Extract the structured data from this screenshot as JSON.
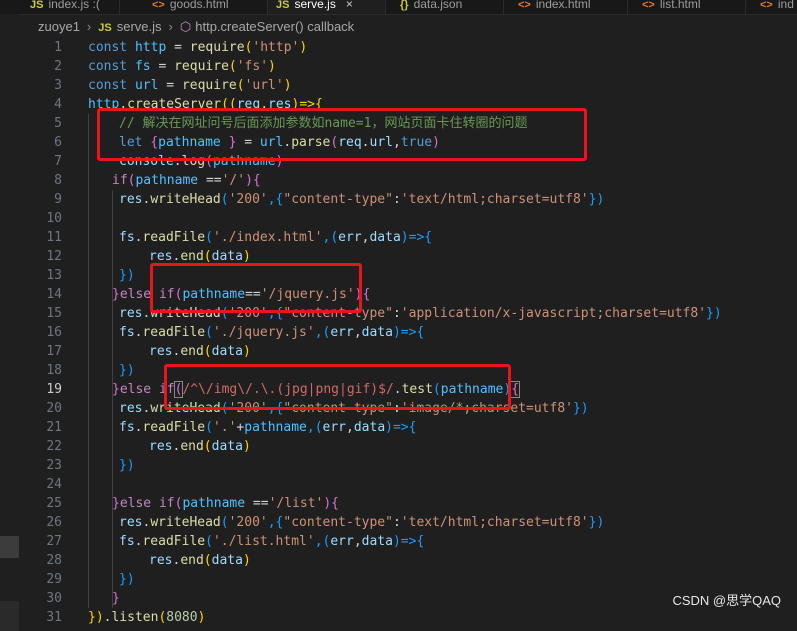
{
  "tabs": [
    {
      "label": "index.js",
      "modified": ":(",
      "icon": "JS"
    },
    {
      "label": "goods.html",
      "icon": "<>"
    },
    {
      "label": "serve.js",
      "icon": "JS",
      "active": true,
      "close": "×"
    },
    {
      "label": "data.json",
      "icon": "{}"
    },
    {
      "label": "index.html",
      "icon": "<>"
    },
    {
      "label": "list.html",
      "icon": "<>"
    },
    {
      "label": "ind",
      "icon": "<>"
    }
  ],
  "breadcrumb": {
    "folder": "zuoye1",
    "file_icon": "JS",
    "file": "serve.js",
    "symbol": "http.createServer() callback"
  },
  "active_line": "19",
  "lines": [
    {
      "n": "1"
    },
    {
      "n": "2"
    },
    {
      "n": "3"
    },
    {
      "n": "4"
    },
    {
      "n": "5"
    },
    {
      "n": "6"
    },
    {
      "n": "7"
    },
    {
      "n": "8"
    },
    {
      "n": "9"
    },
    {
      "n": "10"
    },
    {
      "n": "11"
    },
    {
      "n": "12"
    },
    {
      "n": "13"
    },
    {
      "n": "14"
    },
    {
      "n": "15"
    },
    {
      "n": "16"
    },
    {
      "n": "17"
    },
    {
      "n": "18"
    },
    {
      "n": "19"
    },
    {
      "n": "20"
    },
    {
      "n": "21"
    },
    {
      "n": "22"
    },
    {
      "n": "23"
    },
    {
      "n": "24"
    },
    {
      "n": "25"
    },
    {
      "n": "26"
    },
    {
      "n": "27"
    },
    {
      "n": "28"
    },
    {
      "n": "29"
    },
    {
      "n": "30"
    },
    {
      "n": "31"
    }
  ],
  "code": {
    "l1": [
      "const ",
      "http",
      " = ",
      "require",
      "(",
      "'http'",
      ")"
    ],
    "l2": [
      "const ",
      "fs",
      " = ",
      "require",
      "(",
      "'fs'",
      ")"
    ],
    "l3": [
      "const ",
      "url",
      " = ",
      "require",
      "(",
      "'url'",
      ")"
    ],
    "l4": [
      "http",
      ".",
      "createServer",
      "((",
      "req",
      ",",
      "res",
      ")=>{"
    ],
    "l5": "// 解决在网址问号后面添加参数如name=1，网站页面卡住转圈的问题",
    "l6": [
      "let ",
      "{",
      "pathname ",
      "}",
      " = ",
      "url",
      ".",
      "parse",
      "(",
      "req",
      ".",
      "url",
      ",",
      "true",
      ")"
    ],
    "l7": [
      "console",
      ".",
      "log",
      "(",
      "pathname",
      ")"
    ],
    "l8": [
      "if",
      "(",
      "pathname ",
      "==",
      "'/'",
      "){"
    ],
    "l9": [
      "res",
      ".",
      "writeHead",
      "(",
      "'200'",
      ",{",
      "\"content-type\"",
      ":",
      "'text/html;charset=utf8'",
      "})"
    ],
    "l11": [
      "fs",
      ".",
      "readFile",
      "(",
      "'./index.html'",
      ",(",
      "err",
      ",",
      "data",
      ")=>{"
    ],
    "l12": [
      "res",
      ".",
      "end",
      "(",
      "data",
      ")"
    ],
    "l13": "})",
    "l14": [
      "}",
      "else ",
      "if",
      "(",
      "pathname",
      "==",
      "'/jquery.js'",
      ")",
      "{"
    ],
    "l15": [
      "res",
      ".",
      "writeHead",
      "(",
      "'200'",
      ",{",
      "\"content-type\"",
      ":",
      "'application/x-javascript;charset=utf8'",
      "})"
    ],
    "l16": [
      "fs",
      ".",
      "readFile",
      "(",
      "'./jquery.js'",
      ",(",
      "err",
      ",",
      "data",
      ")=>{"
    ],
    "l17": [
      "res",
      ".",
      "end",
      "(",
      "data",
      ")"
    ],
    "l18": "})",
    "l19": [
      "}",
      "else ",
      "if",
      "(",
      "/^\\/img\\/.\\.(jpg|png|gif)$/",
      ".",
      "test",
      "(",
      "pathname",
      ")",
      "{"
    ],
    "l20": [
      "res",
      ".",
      "writeHead",
      "(",
      "'200'",
      ",{",
      "\"content-type\"",
      ":",
      "'image/*;charset=utf8'",
      "})"
    ],
    "l21": [
      "fs",
      ".",
      "readFile",
      "(",
      "'.'",
      "+",
      "pathname",
      ",(",
      "err",
      ",",
      "data",
      ")=>{"
    ],
    "l22": [
      "res",
      ".",
      "end",
      "(",
      "data",
      ")"
    ],
    "l23": "})",
    "l25": [
      "}",
      "else ",
      "if",
      "(",
      "pathname ",
      "==",
      "'/list'",
      "){"
    ],
    "l26": [
      "res",
      ".",
      "writeHead",
      "(",
      "'200'",
      ",{",
      "\"content-type\"",
      ":",
      "'text/html;charset=utf8'",
      "})"
    ],
    "l27": [
      "fs",
      ".",
      "readFile",
      "(",
      "'./list.html'",
      ",(",
      "err",
      ",",
      "data",
      ")=>{"
    ],
    "l28": [
      "res",
      ".",
      "end",
      "(",
      "data",
      ")"
    ],
    "l29": "})",
    "l30": "}",
    "l31": [
      "})",
      ".",
      "listen",
      "(",
      "8080",
      ")"
    ]
  },
  "watermark": "CSDN @思学QAQ",
  "colors": {
    "annotation_box": "#e8161c",
    "background": "#1f1f1f",
    "keyword": "#569cd6",
    "string": "#ce9178",
    "comment": "#6a9955",
    "regex": "#d16969"
  }
}
